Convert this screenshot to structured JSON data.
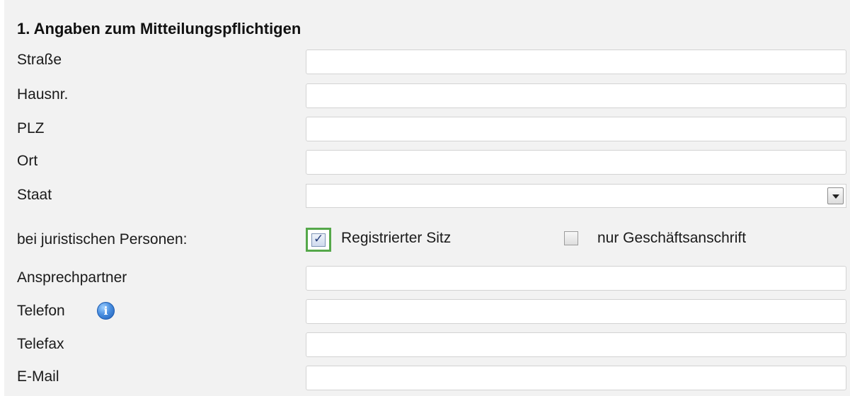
{
  "section": {
    "title": "1. Angaben zum Mitteilungspflichtigen"
  },
  "fields": [
    {
      "key": "strasse",
      "label": "Straße",
      "value": ""
    },
    {
      "key": "hausnr",
      "label": "Hausnr.",
      "value": ""
    },
    {
      "key": "plz",
      "label": "PLZ",
      "value": ""
    },
    {
      "key": "ort",
      "label": "Ort",
      "value": ""
    }
  ],
  "staat": {
    "label": "Staat",
    "selected": ""
  },
  "juristische_personen": {
    "label": "bei juristischen Personen:",
    "options": [
      {
        "label": "Registrierter Sitz",
        "checked": true
      },
      {
        "label": "nur Geschäftsanschrift",
        "checked": false
      }
    ]
  },
  "contact_fields": [
    {
      "key": "ansprechpartner",
      "label": "Ansprechpartner",
      "value": ""
    },
    {
      "key": "telefon",
      "label": "Telefon",
      "value": "",
      "icon": "info-icon"
    },
    {
      "key": "telefax",
      "label": "Telefax",
      "value": ""
    },
    {
      "key": "email",
      "label": "E-Mail",
      "value": ""
    }
  ],
  "colors": {
    "panel_background": "#f2f2f2",
    "focus_border": "#55a84a",
    "info_icon": "#3a7fd6"
  }
}
